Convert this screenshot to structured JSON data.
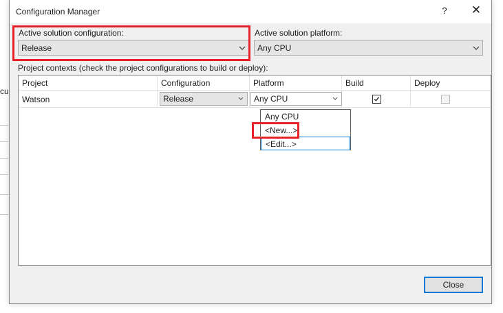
{
  "background_window": {
    "cut_text": "cu"
  },
  "dialog": {
    "title": "Configuration Manager",
    "help_glyph": "?",
    "close_glyph": "✕"
  },
  "active_solution_configuration": {
    "label": "Active solution configuration:",
    "value": "Release"
  },
  "active_solution_platform": {
    "label": "Active solution platform:",
    "value": "Any CPU"
  },
  "project_contexts_label": "Project contexts (check the project configurations to build or deploy):",
  "grid": {
    "columns": [
      "Project",
      "Configuration",
      "Platform",
      "Build",
      "Deploy"
    ],
    "rows": [
      {
        "project": "Watson",
        "configuration": "Release",
        "platform": "Any CPU",
        "build": true,
        "deploy": false
      }
    ]
  },
  "platform_dropdown": {
    "options": [
      "Any CPU",
      "<New...>",
      "<Edit...>"
    ]
  },
  "buttons": {
    "close_label": "Close"
  },
  "colors": {
    "highlight_red": "#e8202a",
    "focus_blue": "#0078d7"
  },
  "icons": [
    "help-icon",
    "close-icon",
    "chevron-down-icon",
    "checkbox-checked-icon",
    "checkbox-disabled-icon"
  ]
}
